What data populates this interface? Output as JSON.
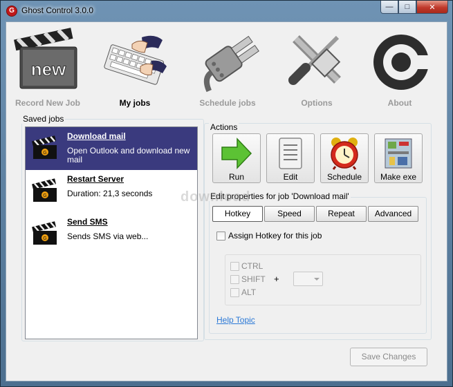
{
  "window": {
    "title": "Ghost Control 3.0.0",
    "app_icon_letter": "G"
  },
  "toolbar": {
    "items": [
      {
        "label": "Record New Job",
        "icon": "new-clapperboard-icon"
      },
      {
        "label": "My jobs",
        "icon": "keyboard-hands-icon"
      },
      {
        "label": "Schedule jobs",
        "icon": "plug-icon"
      },
      {
        "label": "Options",
        "icon": "tools-icon"
      },
      {
        "label": "About",
        "icon": "about-logo-icon"
      }
    ],
    "active": "My jobs"
  },
  "saved_jobs": {
    "title": "Saved jobs",
    "items": [
      {
        "name": "Download mail",
        "description": "Open Outlook and download new mail",
        "selected": true
      },
      {
        "name": "Restart Server",
        "description": "Duration: 21,3 seconds",
        "selected": false
      },
      {
        "name": "Send SMS",
        "description": "Sends SMS via web...",
        "selected": false
      }
    ]
  },
  "actions": {
    "title": "Actions",
    "buttons": [
      {
        "label": "Run",
        "icon": "run-arrow-icon"
      },
      {
        "label": "Edit",
        "icon": "document-icon"
      },
      {
        "label": "Schedule",
        "icon": "alarm-clock-icon"
      },
      {
        "label": "Make exe",
        "icon": "circuit-board-icon"
      }
    ]
  },
  "properties": {
    "title": "Edit properties for job 'Download mail'",
    "tabs": [
      {
        "label": "Hotkey",
        "active": true
      },
      {
        "label": "Speed",
        "active": false
      },
      {
        "label": "Repeat",
        "active": false
      },
      {
        "label": "Advanced",
        "active": false
      }
    ],
    "assign_hotkey_label": "Assign Hotkey for this job",
    "modifiers": [
      "CTRL",
      "SHIFT",
      "ALT"
    ],
    "plus": "+",
    "help_link": "Help Topic"
  },
  "save_button": "Save Changes",
  "watermark": "download"
}
